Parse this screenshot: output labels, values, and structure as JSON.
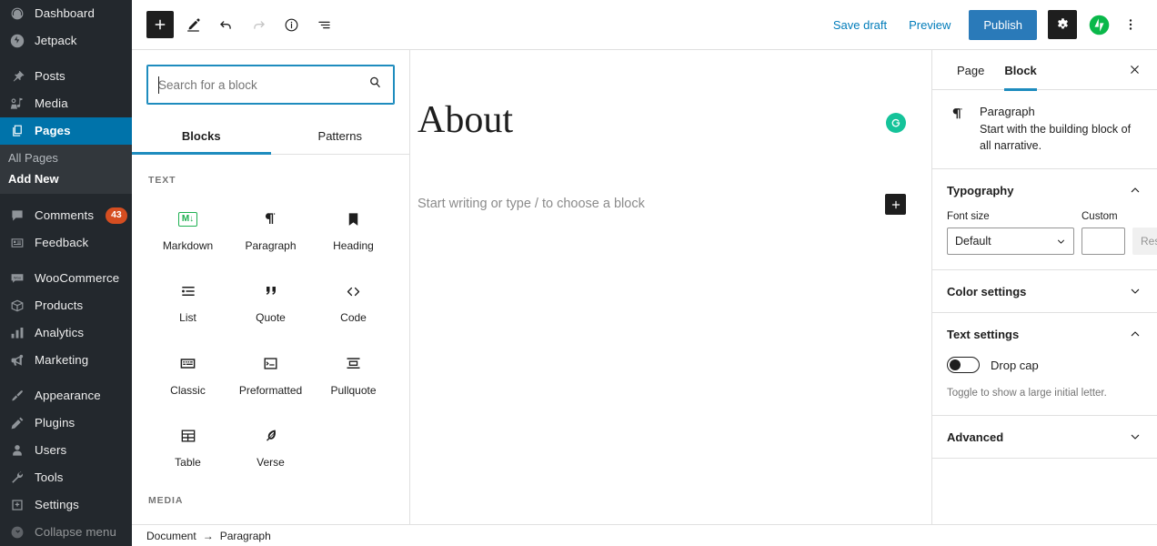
{
  "admin_sidebar": {
    "items": [
      {
        "label": "Dashboard",
        "icon": "dashboard-icon",
        "current": false
      },
      {
        "label": "Jetpack",
        "icon": "jetpack-icon",
        "current": false
      },
      {
        "label": "Posts",
        "icon": "pin-icon",
        "current": false
      },
      {
        "label": "Media",
        "icon": "media-icon",
        "current": false
      },
      {
        "label": "Pages",
        "icon": "pages-icon",
        "current": true
      },
      {
        "label": "Comments",
        "icon": "comments-icon",
        "current": false,
        "badge": "43"
      },
      {
        "label": "Feedback",
        "icon": "feedback-icon",
        "current": false
      },
      {
        "label": "WooCommerce",
        "icon": "woocommerce-icon",
        "current": false
      },
      {
        "label": "Products",
        "icon": "products-icon",
        "current": false
      },
      {
        "label": "Analytics",
        "icon": "analytics-icon",
        "current": false
      },
      {
        "label": "Marketing",
        "icon": "marketing-icon",
        "current": false
      },
      {
        "label": "Appearance",
        "icon": "appearance-icon",
        "current": false
      },
      {
        "label": "Plugins",
        "icon": "plugins-icon",
        "current": false
      },
      {
        "label": "Users",
        "icon": "users-icon",
        "current": false
      },
      {
        "label": "Tools",
        "icon": "tools-icon",
        "current": false
      },
      {
        "label": "Settings",
        "icon": "settings-icon",
        "current": false
      },
      {
        "label": "Collapse menu",
        "icon": "collapse-icon",
        "current": false
      }
    ],
    "submenu": [
      {
        "label": "All Pages",
        "current": false
      },
      {
        "label": "Add New",
        "current": true
      }
    ]
  },
  "header": {
    "toolbar": [
      {
        "name": "add-block",
        "icon": "plus-icon",
        "state": "primary"
      },
      {
        "name": "edit-mode",
        "icon": "pencil-icon",
        "state": "normal"
      },
      {
        "name": "undo",
        "icon": "undo-icon",
        "state": "normal"
      },
      {
        "name": "redo",
        "icon": "redo-icon",
        "state": "disabled"
      },
      {
        "name": "details",
        "icon": "info-icon",
        "state": "normal"
      },
      {
        "name": "list-view",
        "icon": "list-view-icon",
        "state": "normal"
      }
    ],
    "save_draft_label": "Save draft",
    "preview_label": "Preview",
    "publish_label": "Publish",
    "settings_icon": "gear-icon",
    "jetpack_icon": "jetpack-icon",
    "more_icon": "vertical-dots-icon",
    "accent_blue": "#2a7ab9",
    "link_blue": "#007cba"
  },
  "inserter": {
    "search": {
      "placeholder": "Search for a block",
      "value": "",
      "icon": "search-icon"
    },
    "tabs": [
      {
        "label": "Blocks",
        "active": true
      },
      {
        "label": "Patterns",
        "active": false
      }
    ],
    "categories": [
      {
        "label": "TEXT",
        "blocks": [
          {
            "label": "Markdown",
            "icon": "markdown-icon"
          },
          {
            "label": "Paragraph",
            "icon": "pilcrow-icon"
          },
          {
            "label": "Heading",
            "icon": "heading-icon"
          },
          {
            "label": "List",
            "icon": "list-icon"
          },
          {
            "label": "Quote",
            "icon": "quote-icon"
          },
          {
            "label": "Code",
            "icon": "code-icon"
          },
          {
            "label": "Classic",
            "icon": "classic-icon"
          },
          {
            "label": "Preformatted",
            "icon": "preformatted-icon"
          },
          {
            "label": "Pullquote",
            "icon": "pullquote-icon"
          },
          {
            "label": "Table",
            "icon": "table-icon"
          },
          {
            "label": "Verse",
            "icon": "verse-icon"
          }
        ]
      },
      {
        "label": "MEDIA",
        "blocks": []
      }
    ]
  },
  "canvas": {
    "title": "About",
    "paragraph_placeholder": "Start writing or type / to choose a block",
    "grammarly_icon": "grammarly-icon",
    "add_block_icon": "plus-icon"
  },
  "settings": {
    "tabs": [
      {
        "label": "Page",
        "active": false
      },
      {
        "label": "Block",
        "active": true
      }
    ],
    "close_icon": "close-icon",
    "block_card": {
      "icon": "pilcrow-icon",
      "title": "Paragraph",
      "description": "Start with the building block of all narrative."
    },
    "typography": {
      "title": "Typography",
      "expanded": true,
      "font_size_label": "Font size",
      "font_size_value": "Default",
      "font_size_options": [
        "Default"
      ],
      "custom_label": "Custom",
      "custom_value": "",
      "reset_label": "Reset"
    },
    "color_settings": {
      "title": "Color settings",
      "expanded": false
    },
    "text_settings": {
      "title": "Text settings",
      "expanded": true,
      "drop_cap_label": "Drop cap",
      "drop_cap_on": false,
      "drop_cap_help": "Toggle to show a large initial letter."
    },
    "advanced": {
      "title": "Advanced",
      "expanded": false
    }
  },
  "footer": {
    "breadcrumb": [
      {
        "label": "Document"
      },
      {
        "label": "Paragraph"
      }
    ],
    "separator": "→"
  }
}
